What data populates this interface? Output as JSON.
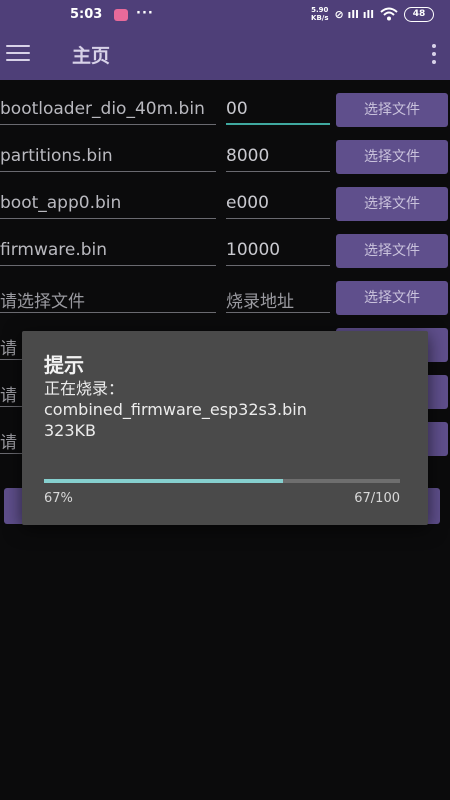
{
  "status_bar": {
    "time": "5:03",
    "more": "···",
    "speed_top": "5.90",
    "speed_bottom": "KB/s",
    "signal_text": "⊘ ıll ıll",
    "battery": "48"
  },
  "app_bar": {
    "title": "主页"
  },
  "rows": [
    {
      "file": "bootloader_dio_40m.bin",
      "address": "00",
      "button": "选择文件"
    },
    {
      "file": "partitions.bin",
      "address": "8000",
      "button": "选择文件"
    },
    {
      "file": "boot_app0.bin",
      "address": "e000",
      "button": "选择文件"
    },
    {
      "file": "firmware.bin",
      "address": "10000",
      "button": "选择文件"
    },
    {
      "file_placeholder": "请选择文件",
      "address_placeholder": "烧录地址",
      "button": "选择文件"
    },
    {
      "file_placeholder": "请",
      "button": ""
    },
    {
      "file_placeholder": "请",
      "button": ""
    },
    {
      "file_placeholder": "请",
      "button": ""
    }
  ],
  "dialog": {
    "title": "提示",
    "line1": "正在烧录：",
    "line2": "combined_firmware_esp32s3.bin",
    "line3": "323KB",
    "progress": 0.67,
    "percent_label": "67%",
    "count_label": "67/100"
  },
  "colors": {
    "app_bar": "#4e3f78",
    "button": "#5f4f8c",
    "focus_underline": "#3fa9a0",
    "progress_fill": "#86d0cf",
    "dialog_bg": "#4a4a4a"
  }
}
